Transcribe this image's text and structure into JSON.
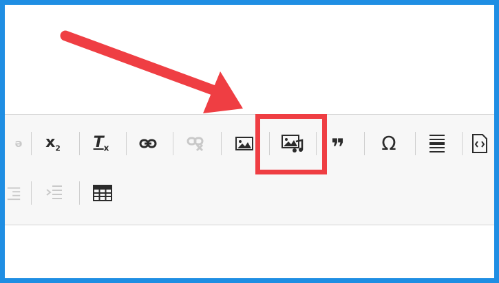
{
  "toolbar": {
    "row1": [
      {
        "name": "partial-icon-button",
        "icon": "formatting-partial-icon",
        "glyph": "ǝ",
        "enabled": false
      },
      {
        "name": "subscript-button",
        "icon": "subscript-icon",
        "glyph": "x",
        "sub": "2",
        "enabled": true
      },
      {
        "name": "remove-format-button",
        "icon": "remove-format-icon",
        "glyph": "T",
        "sub": "x",
        "enabled": true
      },
      {
        "name": "link-button",
        "icon": "link-icon",
        "enabled": true
      },
      {
        "name": "unlink-button",
        "icon": "unlink-icon",
        "enabled": false
      },
      {
        "name": "image-button",
        "icon": "image-icon",
        "enabled": true
      },
      {
        "name": "media-embed-button",
        "icon": "media-icon",
        "enabled": true,
        "highlighted": true
      },
      {
        "name": "blockquote-button",
        "icon": "blockquote-icon",
        "glyph": "❞",
        "enabled": true
      },
      {
        "name": "special-char-button",
        "icon": "omega-icon",
        "glyph": "Ω",
        "enabled": true
      },
      {
        "name": "horizontal-line-button",
        "icon": "horizontal-line-icon",
        "enabled": true
      },
      {
        "name": "source-button",
        "icon": "source-code-icon",
        "enabled": true
      }
    ],
    "row2": [
      {
        "name": "outdent-button",
        "icon": "outdent-icon",
        "enabled": false
      },
      {
        "name": "indent-button",
        "icon": "indent-icon",
        "enabled": false
      },
      {
        "name": "table-button",
        "icon": "table-icon",
        "enabled": true
      }
    ]
  },
  "annotation": {
    "arrow_color": "#ef3e43",
    "box_color": "#ef3e43"
  },
  "frame": {
    "border_color": "#1f8ee3"
  }
}
